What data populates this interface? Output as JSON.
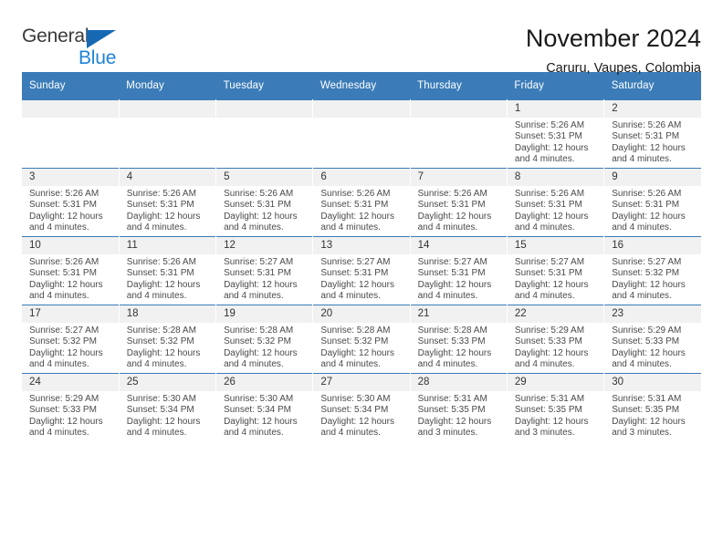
{
  "brand": {
    "word_general": "General",
    "word_blue": "Blue",
    "triangle_color": "#1668b3",
    "blue_text_color": "#1f84d6"
  },
  "header": {
    "title": "November 2024",
    "subtitle": "Caruru, Vaupes, Colombia",
    "header_bg_color": "#3b7cb8",
    "daynum_bg_color": "#f1f1f1"
  },
  "weekday_headers": [
    "Sunday",
    "Monday",
    "Tuesday",
    "Wednesday",
    "Thursday",
    "Friday",
    "Saturday"
  ],
  "labels": {
    "sunrise_prefix": "Sunrise:",
    "sunset_prefix": "Sunset:",
    "daylight_prefix": "Daylight:"
  },
  "weeks": [
    [
      {
        "day": "",
        "empty": true
      },
      {
        "day": "",
        "empty": true
      },
      {
        "day": "",
        "empty": true
      },
      {
        "day": "",
        "empty": true
      },
      {
        "day": "",
        "empty": true
      },
      {
        "day": "1",
        "sunrise": "Sunrise: 5:26 AM",
        "sunset": "Sunset: 5:31 PM",
        "daylight": "Daylight: 12 hours and 4 minutes."
      },
      {
        "day": "2",
        "sunrise": "Sunrise: 5:26 AM",
        "sunset": "Sunset: 5:31 PM",
        "daylight": "Daylight: 12 hours and 4 minutes."
      }
    ],
    [
      {
        "day": "3",
        "sunrise": "Sunrise: 5:26 AM",
        "sunset": "Sunset: 5:31 PM",
        "daylight": "Daylight: 12 hours and 4 minutes."
      },
      {
        "day": "4",
        "sunrise": "Sunrise: 5:26 AM",
        "sunset": "Sunset: 5:31 PM",
        "daylight": "Daylight: 12 hours and 4 minutes."
      },
      {
        "day": "5",
        "sunrise": "Sunrise: 5:26 AM",
        "sunset": "Sunset: 5:31 PM",
        "daylight": "Daylight: 12 hours and 4 minutes."
      },
      {
        "day": "6",
        "sunrise": "Sunrise: 5:26 AM",
        "sunset": "Sunset: 5:31 PM",
        "daylight": "Daylight: 12 hours and 4 minutes."
      },
      {
        "day": "7",
        "sunrise": "Sunrise: 5:26 AM",
        "sunset": "Sunset: 5:31 PM",
        "daylight": "Daylight: 12 hours and 4 minutes."
      },
      {
        "day": "8",
        "sunrise": "Sunrise: 5:26 AM",
        "sunset": "Sunset: 5:31 PM",
        "daylight": "Daylight: 12 hours and 4 minutes."
      },
      {
        "day": "9",
        "sunrise": "Sunrise: 5:26 AM",
        "sunset": "Sunset: 5:31 PM",
        "daylight": "Daylight: 12 hours and 4 minutes."
      }
    ],
    [
      {
        "day": "10",
        "sunrise": "Sunrise: 5:26 AM",
        "sunset": "Sunset: 5:31 PM",
        "daylight": "Daylight: 12 hours and 4 minutes."
      },
      {
        "day": "11",
        "sunrise": "Sunrise: 5:26 AM",
        "sunset": "Sunset: 5:31 PM",
        "daylight": "Daylight: 12 hours and 4 minutes."
      },
      {
        "day": "12",
        "sunrise": "Sunrise: 5:27 AM",
        "sunset": "Sunset: 5:31 PM",
        "daylight": "Daylight: 12 hours and 4 minutes."
      },
      {
        "day": "13",
        "sunrise": "Sunrise: 5:27 AM",
        "sunset": "Sunset: 5:31 PM",
        "daylight": "Daylight: 12 hours and 4 minutes."
      },
      {
        "day": "14",
        "sunrise": "Sunrise: 5:27 AM",
        "sunset": "Sunset: 5:31 PM",
        "daylight": "Daylight: 12 hours and 4 minutes."
      },
      {
        "day": "15",
        "sunrise": "Sunrise: 5:27 AM",
        "sunset": "Sunset: 5:31 PM",
        "daylight": "Daylight: 12 hours and 4 minutes."
      },
      {
        "day": "16",
        "sunrise": "Sunrise: 5:27 AM",
        "sunset": "Sunset: 5:32 PM",
        "daylight": "Daylight: 12 hours and 4 minutes."
      }
    ],
    [
      {
        "day": "17",
        "sunrise": "Sunrise: 5:27 AM",
        "sunset": "Sunset: 5:32 PM",
        "daylight": "Daylight: 12 hours and 4 minutes."
      },
      {
        "day": "18",
        "sunrise": "Sunrise: 5:28 AM",
        "sunset": "Sunset: 5:32 PM",
        "daylight": "Daylight: 12 hours and 4 minutes."
      },
      {
        "day": "19",
        "sunrise": "Sunrise: 5:28 AM",
        "sunset": "Sunset: 5:32 PM",
        "daylight": "Daylight: 12 hours and 4 minutes."
      },
      {
        "day": "20",
        "sunrise": "Sunrise: 5:28 AM",
        "sunset": "Sunset: 5:32 PM",
        "daylight": "Daylight: 12 hours and 4 minutes."
      },
      {
        "day": "21",
        "sunrise": "Sunrise: 5:28 AM",
        "sunset": "Sunset: 5:33 PM",
        "daylight": "Daylight: 12 hours and 4 minutes."
      },
      {
        "day": "22",
        "sunrise": "Sunrise: 5:29 AM",
        "sunset": "Sunset: 5:33 PM",
        "daylight": "Daylight: 12 hours and 4 minutes."
      },
      {
        "day": "23",
        "sunrise": "Sunrise: 5:29 AM",
        "sunset": "Sunset: 5:33 PM",
        "daylight": "Daylight: 12 hours and 4 minutes."
      }
    ],
    [
      {
        "day": "24",
        "sunrise": "Sunrise: 5:29 AM",
        "sunset": "Sunset: 5:33 PM",
        "daylight": "Daylight: 12 hours and 4 minutes."
      },
      {
        "day": "25",
        "sunrise": "Sunrise: 5:30 AM",
        "sunset": "Sunset: 5:34 PM",
        "daylight": "Daylight: 12 hours and 4 minutes."
      },
      {
        "day": "26",
        "sunrise": "Sunrise: 5:30 AM",
        "sunset": "Sunset: 5:34 PM",
        "daylight": "Daylight: 12 hours and 4 minutes."
      },
      {
        "day": "27",
        "sunrise": "Sunrise: 5:30 AM",
        "sunset": "Sunset: 5:34 PM",
        "daylight": "Daylight: 12 hours and 4 minutes."
      },
      {
        "day": "28",
        "sunrise": "Sunrise: 5:31 AM",
        "sunset": "Sunset: 5:35 PM",
        "daylight": "Daylight: 12 hours and 3 minutes."
      },
      {
        "day": "29",
        "sunrise": "Sunrise: 5:31 AM",
        "sunset": "Sunset: 5:35 PM",
        "daylight": "Daylight: 12 hours and 3 minutes."
      },
      {
        "day": "30",
        "sunrise": "Sunrise: 5:31 AM",
        "sunset": "Sunset: 5:35 PM",
        "daylight": "Daylight: 12 hours and 3 minutes."
      }
    ]
  ]
}
